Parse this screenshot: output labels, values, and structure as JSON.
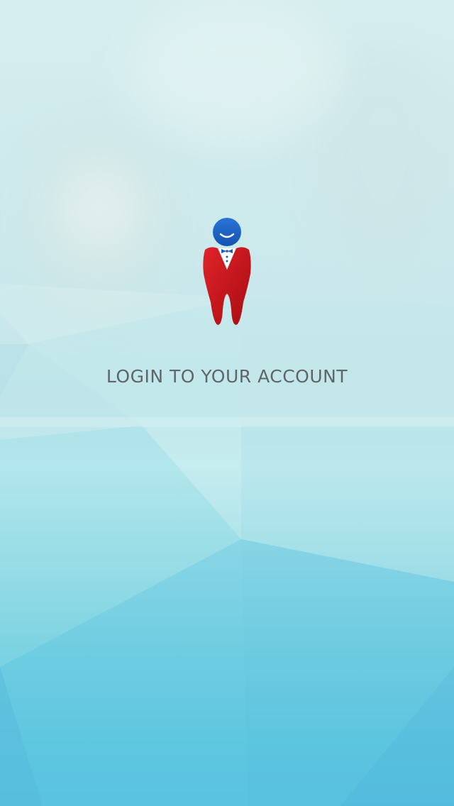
{
  "screen": {
    "title": "LOGIN TO YOUR ACCOUNT",
    "logo_icon": "tooth-butler-icon"
  },
  "colors": {
    "tooth": "#d2141a",
    "head": "#1a61c6",
    "title_text": "#5f6668",
    "bg_top": "#d6eeef",
    "bg_bottom": "#56bfdf"
  }
}
